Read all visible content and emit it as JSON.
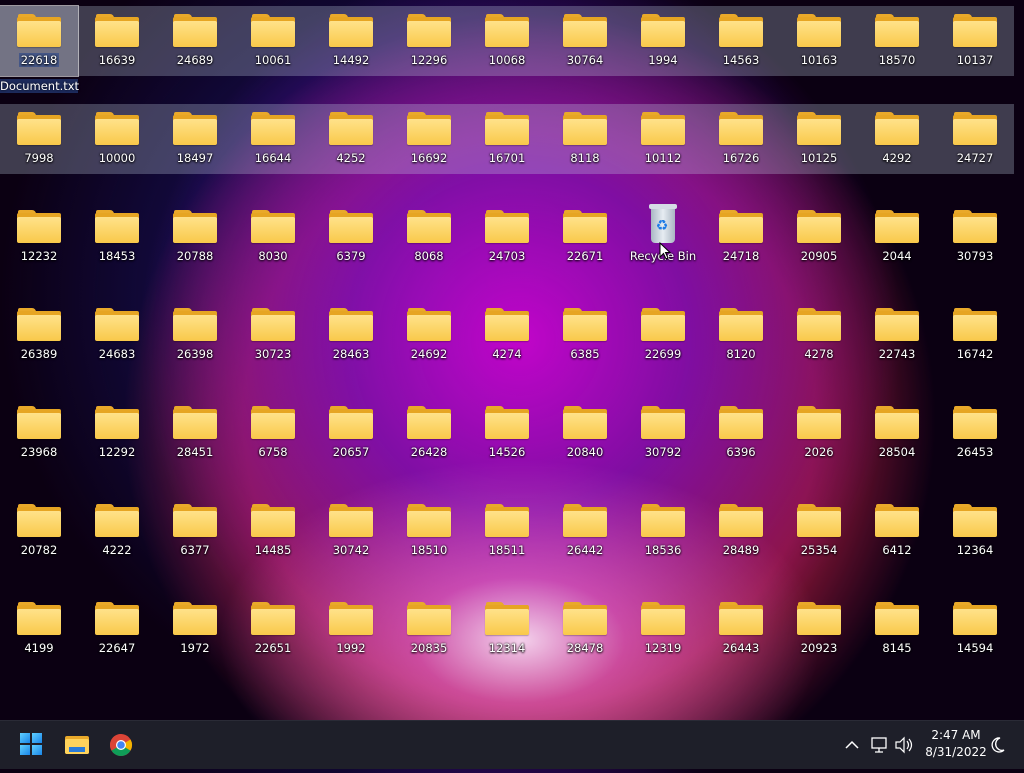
{
  "desktop": {
    "row1": [
      "22618",
      "16639",
      "24689",
      "10061",
      "14492",
      "12296",
      "10068",
      "30764",
      "1994",
      "14563",
      "10163",
      "18570",
      "10137"
    ],
    "row2": [
      "7998",
      "10000",
      "18497",
      "16644",
      "4252",
      "16692",
      "16701",
      "8118",
      "10112",
      "16726",
      "10125",
      "4292",
      "24727"
    ],
    "row3": [
      "12232",
      "18453",
      "20788",
      "8030",
      "6379",
      "8068",
      "24703",
      "22671",
      "Recycle Bin",
      "24718",
      "20905",
      "2044",
      "30793"
    ],
    "row4": [
      "26389",
      "24683",
      "26398",
      "30723",
      "28463",
      "24692",
      "4274",
      "6385",
      "22699",
      "8120",
      "4278",
      "22743",
      "16742"
    ],
    "row5": [
      "23968",
      "12292",
      "28451",
      "6758",
      "20657",
      "26428",
      "14526",
      "20840",
      "30792",
      "6396",
      "2026",
      "28504",
      "26453"
    ],
    "row6": [
      "20782",
      "4222",
      "6377",
      "14485",
      "30742",
      "18510",
      "18511",
      "26442",
      "18536",
      "28489",
      "25354",
      "6412",
      "12364"
    ],
    "row7": [
      "4199",
      "22647",
      "1972",
      "22651",
      "1992",
      "20835",
      "12314",
      "28478",
      "12319",
      "26443",
      "20923",
      "8145",
      "14594"
    ],
    "renaming_suffix": "Document.txt"
  },
  "taskbar": {
    "apps": [
      "start-button",
      "file-explorer",
      "google-chrome"
    ],
    "tray_icons": [
      "chevron-up-icon",
      "network-icon",
      "volume-icon"
    ],
    "time": "2:47 AM",
    "date": "8/31/2022",
    "colors": {
      "bg": "#1e1f29",
      "start_accent": "#1a85e8",
      "folder": "#f9c94a"
    }
  }
}
